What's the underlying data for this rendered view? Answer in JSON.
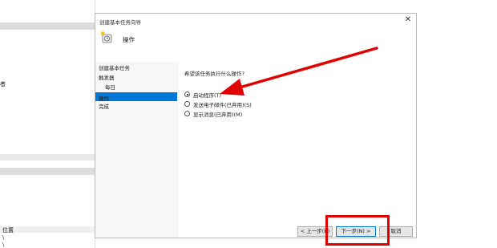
{
  "background_window": {
    "label_1": "者",
    "column_location": "位置",
    "row_1": "\\",
    "row_2": "\\"
  },
  "dialog": {
    "title": "创建基本任务向导",
    "header_title": "操作",
    "sidebar": [
      {
        "label": "创建基本任务",
        "indent": false,
        "selected": false
      },
      {
        "label": "触发器",
        "indent": false,
        "selected": false
      },
      {
        "label": "每日",
        "indent": true,
        "selected": false
      },
      {
        "label": "操作",
        "indent": false,
        "selected": true
      },
      {
        "label": "完成",
        "indent": false,
        "selected": false
      }
    ],
    "question": "希望该任务执行什么操作?",
    "options": [
      {
        "label": "启动程序(T)",
        "selected": true
      },
      {
        "label": "发送电子邮件(已弃用)(S)",
        "selected": false
      },
      {
        "label": "显示消息(已弃用)(M)",
        "selected": false
      }
    ],
    "buttons": {
      "back": "< 上一步(B)",
      "next": "下一步(N) >",
      "cancel": "取消"
    }
  },
  "annotation_color": "#e00000",
  "accent_color": "#0078d7"
}
